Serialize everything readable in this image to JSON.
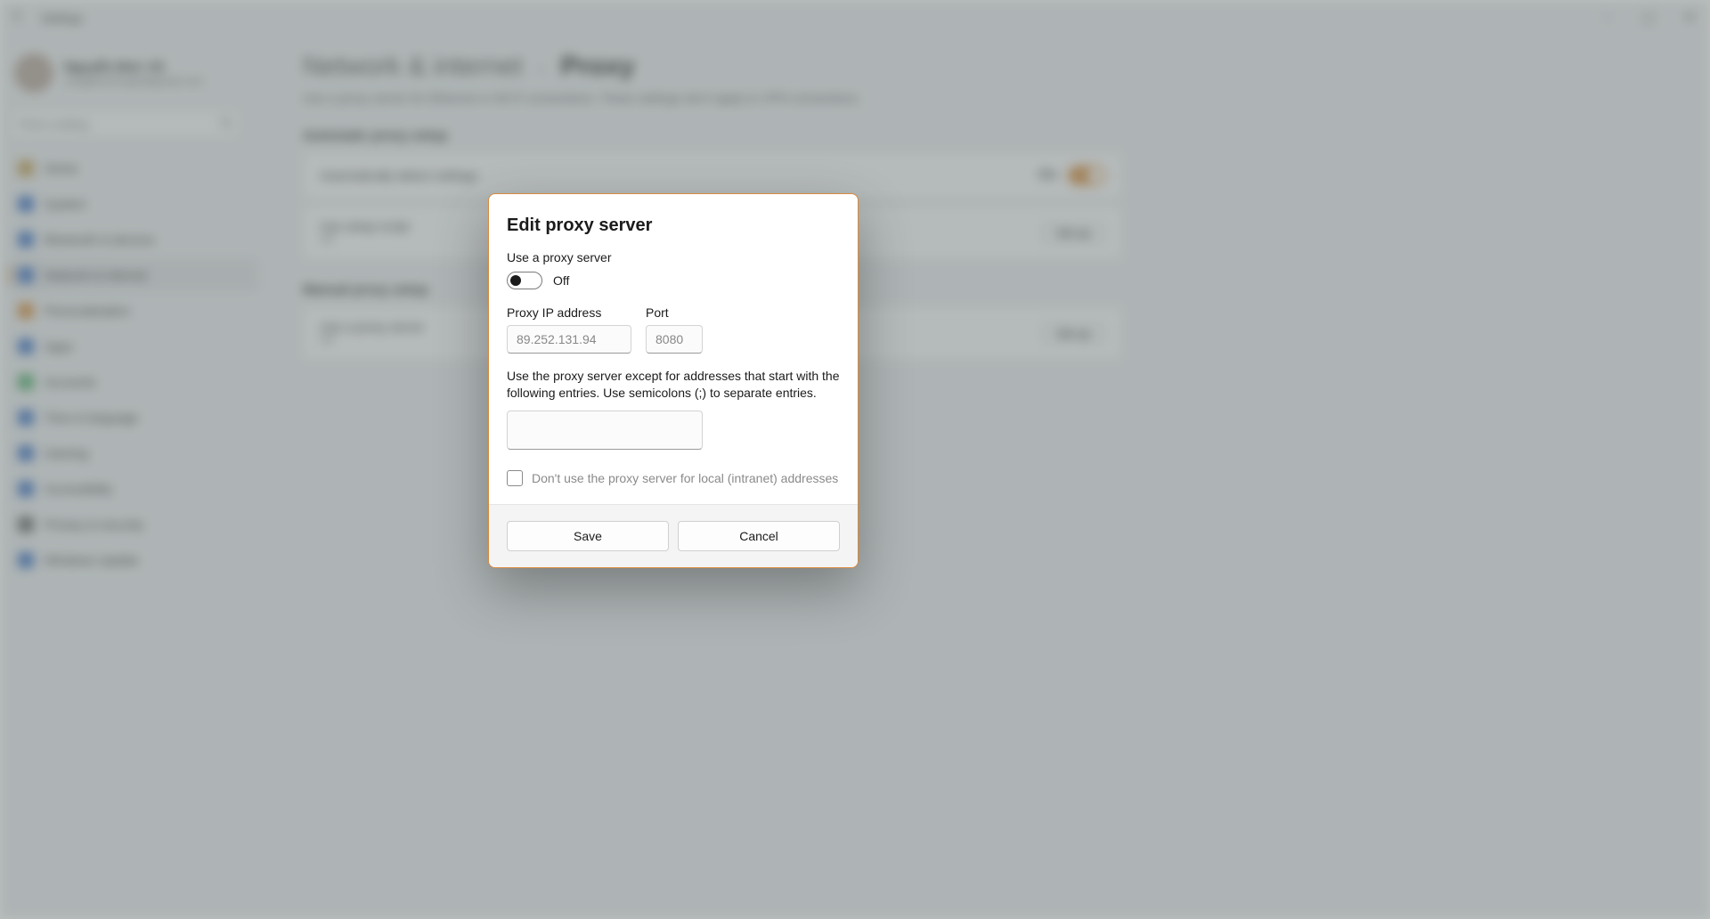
{
  "window": {
    "title": "Settings",
    "controls": {
      "min": "–",
      "max": "▢",
      "close": "✕"
    }
  },
  "profile": {
    "name": "Nguyễn Đức Vũ",
    "email": "vungphunhungm@gmail.com"
  },
  "search": {
    "placeholder": "Find a setting"
  },
  "sidebar": {
    "items": [
      {
        "label": "Home",
        "color": "#c9a24b"
      },
      {
        "label": "System",
        "color": "#3a77d4"
      },
      {
        "label": "Bluetooth & devices",
        "color": "#3a77d4"
      },
      {
        "label": "Network & internet",
        "color": "#3a77d4",
        "selected": true
      },
      {
        "label": "Personalization",
        "color": "#e39035"
      },
      {
        "label": "Apps",
        "color": "#3a77d4"
      },
      {
        "label": "Accounts",
        "color": "#4bb36a"
      },
      {
        "label": "Time & language",
        "color": "#3a77d4"
      },
      {
        "label": "Gaming",
        "color": "#3a77d4"
      },
      {
        "label": "Accessibility",
        "color": "#3a77d4"
      },
      {
        "label": "Privacy & security",
        "color": "#6a6a6a"
      },
      {
        "label": "Windows Update",
        "color": "#3a77d4"
      }
    ]
  },
  "content": {
    "breadcrumb_root": "Network & internet",
    "breadcrumb_sep": "›",
    "breadcrumb_leaf": "Proxy",
    "subtitle": "Use a proxy server for Ethernet or Wi‑Fi connections. These settings don't apply to VPN connections.",
    "sections": {
      "auto": {
        "heading": "Automatic proxy setup",
        "detect_label": "Automatically detect settings",
        "detect_on_text": "On",
        "script_label": "Use setup script",
        "script_sub": "Off",
        "setup_btn": "Set up"
      },
      "manual": {
        "heading": "Manual proxy setup",
        "row_label": "Use a proxy server",
        "row_sub": "Off",
        "setup_btn": "Set up"
      }
    }
  },
  "dialog": {
    "title": "Edit proxy server",
    "use_proxy_label": "Use a proxy server",
    "toggle_state": "Off",
    "ip_label": "Proxy IP address",
    "ip_value": "89.252.131.94",
    "port_label": "Port",
    "port_value": "8080",
    "exceptions_label": "Use the proxy server except for addresses that start with the following entries. Use semicolons (;) to separate entries.",
    "exceptions_value": "",
    "local_checkbox_label": "Don't use the proxy server for local (intranet) addresses",
    "save": "Save",
    "cancel": "Cancel"
  }
}
